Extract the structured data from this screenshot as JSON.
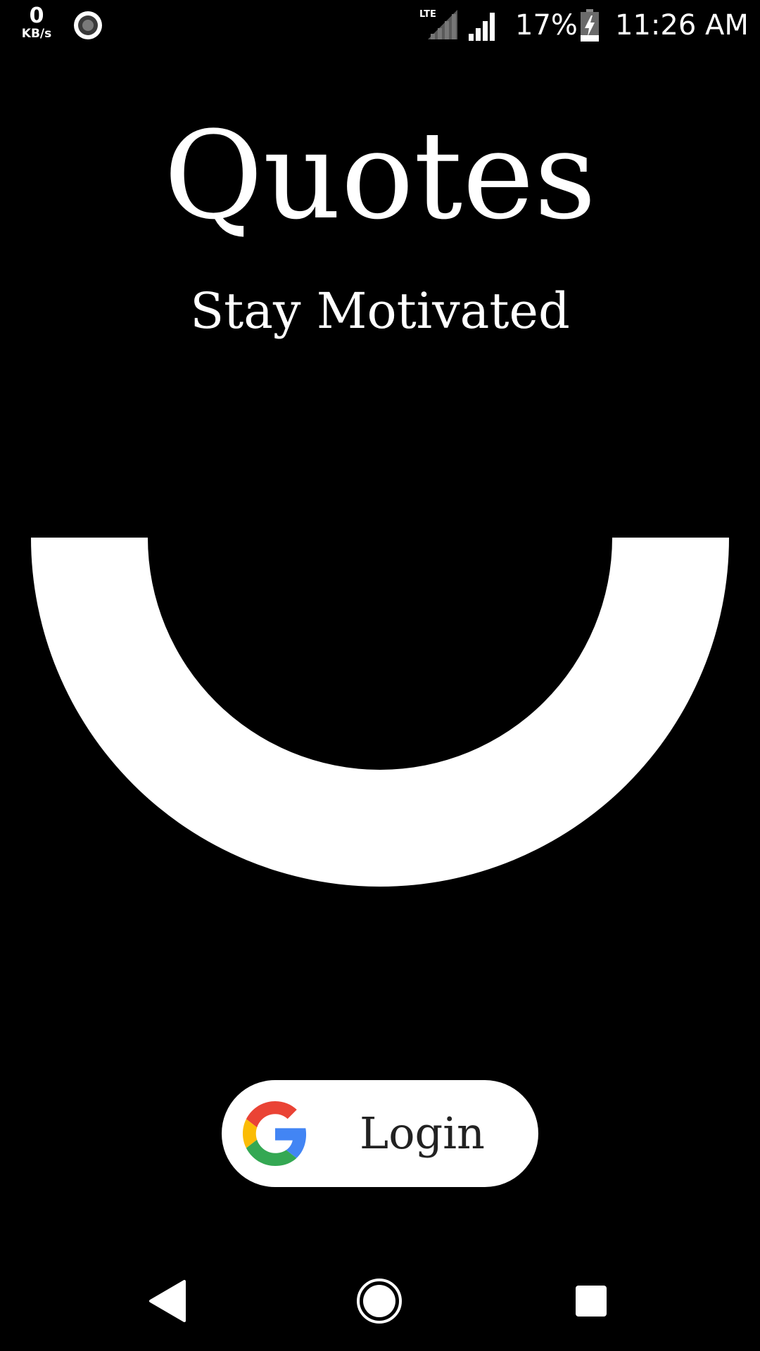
{
  "status_bar": {
    "net_speed_value": "0",
    "net_speed_unit": "KB/s",
    "network_type": "LTE",
    "battery_percent": "17%",
    "time": "11:26 AM",
    "icons": [
      "screen-record-icon",
      "lte-signal-icon",
      "signal-icon",
      "battery-charging-icon"
    ]
  },
  "header": {
    "title": "Quotes",
    "subtitle": "Stay Motivated"
  },
  "logo": {
    "icon": "half-ring-logo-icon",
    "color": "#ffffff"
  },
  "login": {
    "label": "Login",
    "icon": "google-icon",
    "background": "#ffffff",
    "text_color": "#222222"
  },
  "nav_bar": {
    "icons": [
      "back-icon",
      "home-icon",
      "recents-icon"
    ]
  },
  "colors": {
    "background": "#000000",
    "foreground": "#ffffff",
    "google_red": "#EA4335",
    "google_yellow": "#FBBC05",
    "google_green": "#34A853",
    "google_blue": "#4285F4"
  }
}
